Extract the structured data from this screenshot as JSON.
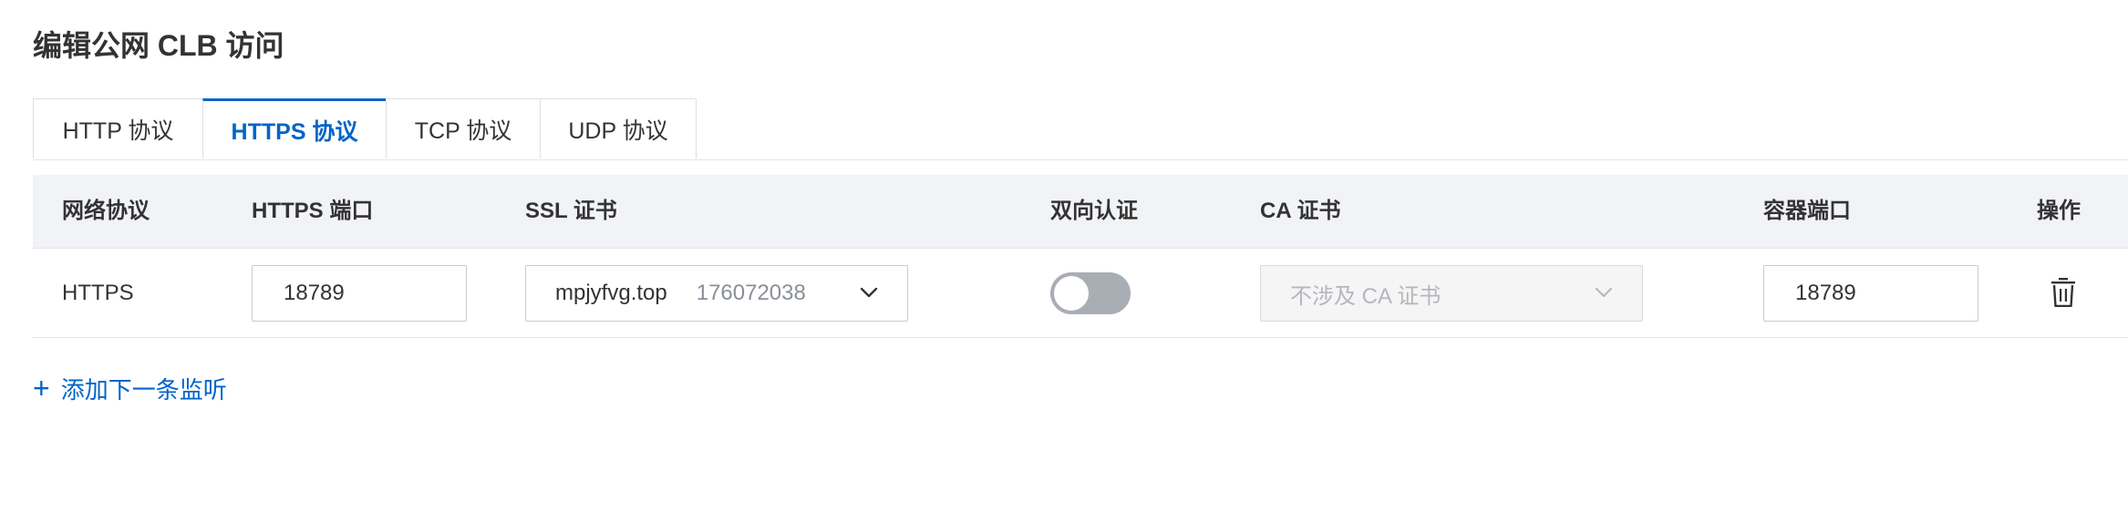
{
  "page": {
    "title": "编辑公网 CLB 访问"
  },
  "tabs": [
    {
      "label": "HTTP 协议",
      "active": false
    },
    {
      "label": "HTTPS 协议",
      "active": true
    },
    {
      "label": "TCP 协议",
      "active": false
    },
    {
      "label": "UDP 协议",
      "active": false
    }
  ],
  "table": {
    "headers": {
      "protocol": "网络协议",
      "https_port": "HTTPS 端口",
      "ssl_cert": "SSL 证书",
      "mutual_auth": "双向认证",
      "ca_cert": "CA 证书",
      "container_port": "容器端口",
      "actions": "操作"
    },
    "rows": [
      {
        "protocol": "HTTPS",
        "https_port": "18789",
        "ssl_cert_domain": "mpjyfvg.top",
        "ssl_cert_id": "176072038",
        "mutual_auth_enabled": false,
        "ca_cert_placeholder": "不涉及 CA 证书",
        "container_port": "18789"
      }
    ]
  },
  "actions": {
    "add_listener_label": "添加下一条监听",
    "add_icon": "plus-icon",
    "delete_icon": "trash-icon",
    "select_icon": "chevron-down-icon"
  },
  "colors": {
    "accent": "#0064c8",
    "header_bg": "#f1f3f6",
    "toggle_off": "#a9adb4"
  }
}
